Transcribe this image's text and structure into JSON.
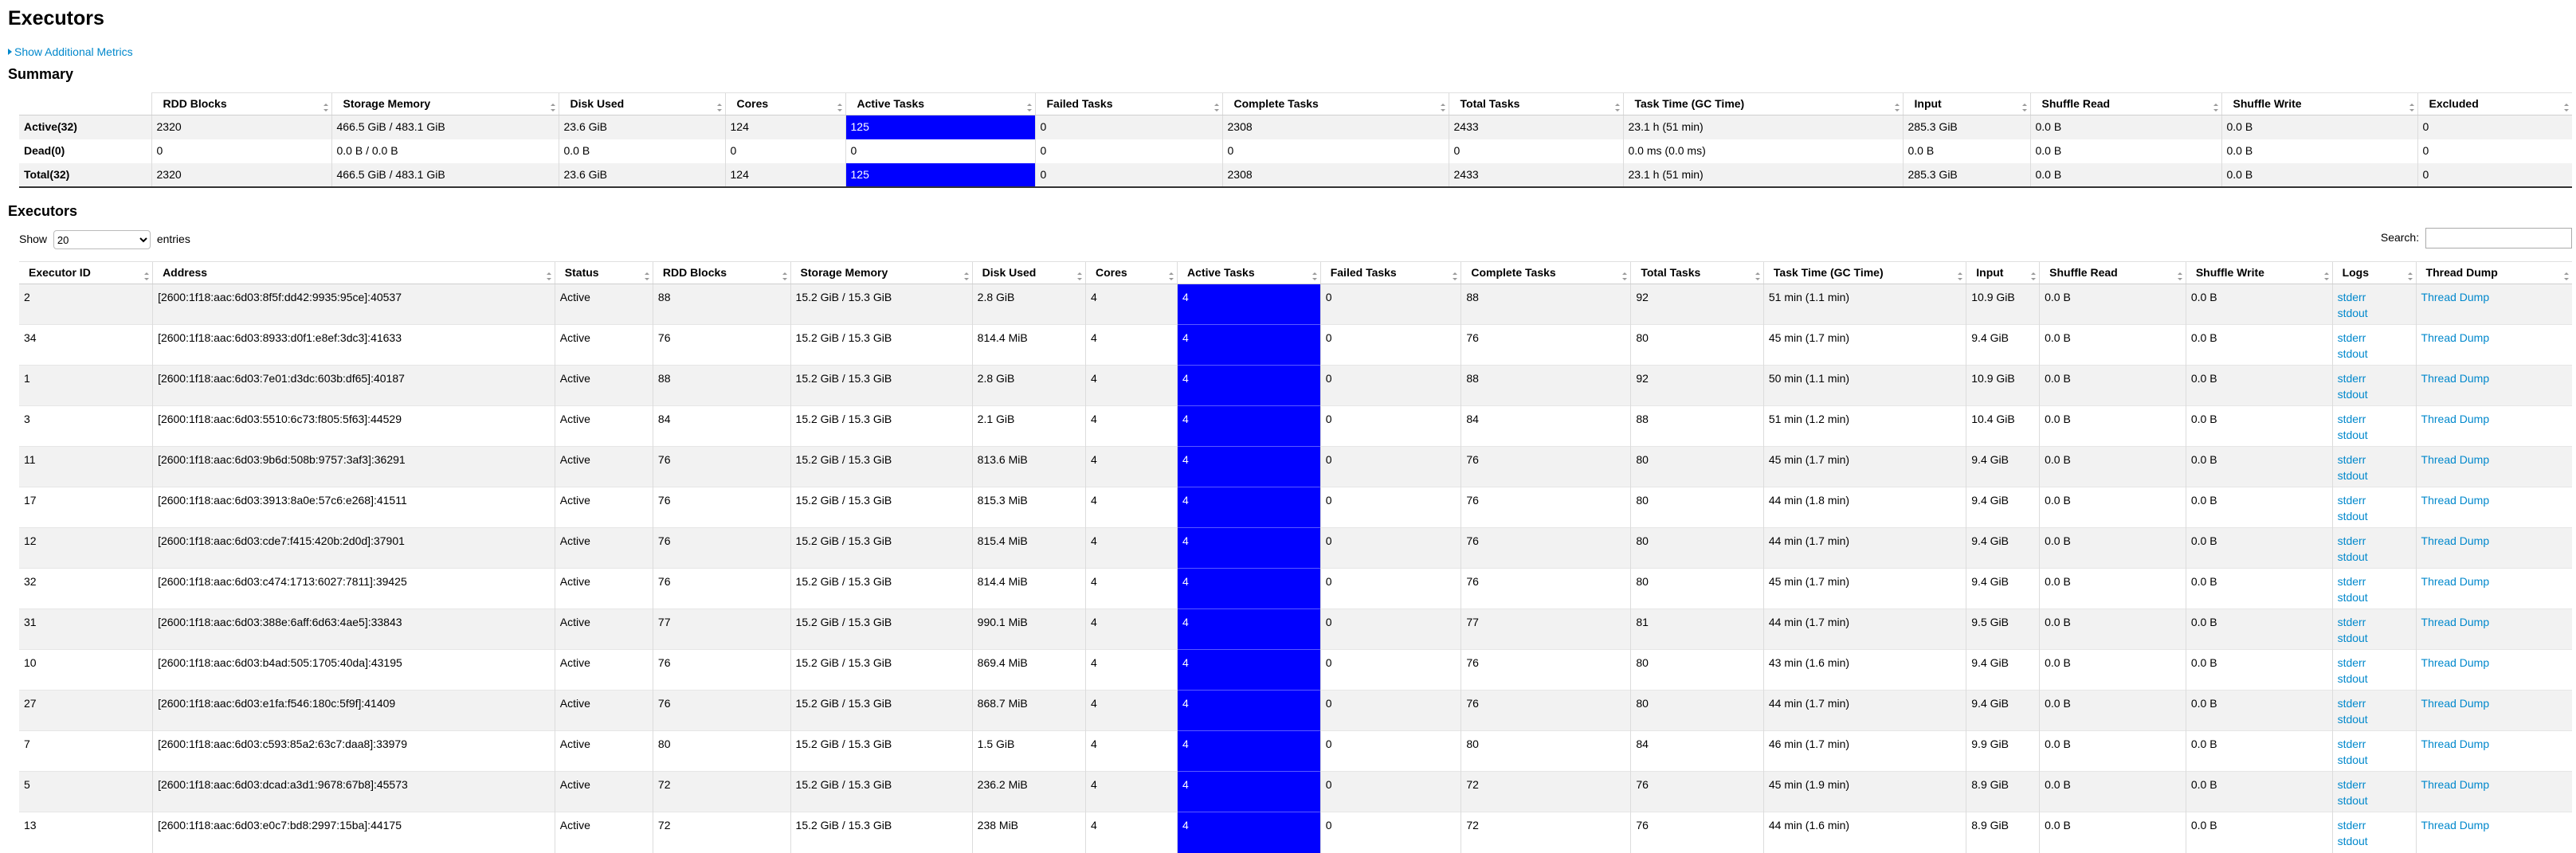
{
  "page_title": "Executors",
  "show_metrics_label": "Show Additional Metrics",
  "summary": {
    "title": "Summary",
    "columns": [
      "",
      "RDD Blocks",
      "Storage Memory",
      "Disk Used",
      "Cores",
      "Active Tasks",
      "Failed Tasks",
      "Complete Tasks",
      "Total Tasks",
      "Task Time (GC Time)",
      "Input",
      "Shuffle Read",
      "Shuffle Write",
      "Excluded"
    ],
    "rows": [
      [
        "Active(32)",
        "2320",
        "466.5 GiB / 483.1 GiB",
        "23.6 GiB",
        "124",
        "125",
        "0",
        "2308",
        "2433",
        "23.1 h (51 min)",
        "285.3 GiB",
        "0.0 B",
        "0.0 B",
        "0"
      ],
      [
        "Dead(0)",
        "0",
        "0.0 B / 0.0 B",
        "0.0 B",
        "0",
        "0",
        "0",
        "0",
        "0",
        "0.0 ms (0.0 ms)",
        "0.0 B",
        "0.0 B",
        "0.0 B",
        "0"
      ],
      [
        "Total(32)",
        "2320",
        "466.5 GiB / 483.1 GiB",
        "23.6 GiB",
        "124",
        "125",
        "0",
        "2308",
        "2433",
        "23.1 h (51 min)",
        "285.3 GiB",
        "0.0 B",
        "0.0 B",
        "0"
      ]
    ]
  },
  "executors": {
    "title": "Executors",
    "show_label": "Show",
    "entries_label": "entries",
    "page_size": "20",
    "search_label": "Search:",
    "search_value": "",
    "columns": [
      "Executor ID",
      "Address",
      "Status",
      "RDD Blocks",
      "Storage Memory",
      "Disk Used",
      "Cores",
      "Active Tasks",
      "Failed Tasks",
      "Complete Tasks",
      "Total Tasks",
      "Task Time (GC Time)",
      "Input",
      "Shuffle Read",
      "Shuffle Write",
      "Logs",
      "Thread Dump"
    ],
    "stderr_label": "stderr",
    "stdout_label": "stdout",
    "thread_dump_label": "Thread Dump",
    "rows": [
      [
        "2",
        "[2600:1f18:aac:6d03:8f5f:dd42:9935:95ce]:40537",
        "Active",
        "88",
        "15.2 GiB / 15.3 GiB",
        "2.8 GiB",
        "4",
        "4",
        "0",
        "88",
        "92",
        "51 min (1.1 min)",
        "10.9 GiB",
        "0.0 B",
        "0.0 B"
      ],
      [
        "34",
        "[2600:1f18:aac:6d03:8933:d0f1:e8ef:3dc3]:41633",
        "Active",
        "76",
        "15.2 GiB / 15.3 GiB",
        "814.4 MiB",
        "4",
        "4",
        "0",
        "76",
        "80",
        "45 min (1.7 min)",
        "9.4 GiB",
        "0.0 B",
        "0.0 B"
      ],
      [
        "1",
        "[2600:1f18:aac:6d03:7e01:d3dc:603b:df65]:40187",
        "Active",
        "88",
        "15.2 GiB / 15.3 GiB",
        "2.8 GiB",
        "4",
        "4",
        "0",
        "88",
        "92",
        "50 min (1.1 min)",
        "10.9 GiB",
        "0.0 B",
        "0.0 B"
      ],
      [
        "3",
        "[2600:1f18:aac:6d03:5510:6c73:f805:5f63]:44529",
        "Active",
        "84",
        "15.2 GiB / 15.3 GiB",
        "2.1 GiB",
        "4",
        "4",
        "0",
        "84",
        "88",
        "51 min (1.2 min)",
        "10.4 GiB",
        "0.0 B",
        "0.0 B"
      ],
      [
        "11",
        "[2600:1f18:aac:6d03:9b6d:508b:9757:3af3]:36291",
        "Active",
        "76",
        "15.2 GiB / 15.3 GiB",
        "813.6 MiB",
        "4",
        "4",
        "0",
        "76",
        "80",
        "45 min (1.7 min)",
        "9.4 GiB",
        "0.0 B",
        "0.0 B"
      ],
      [
        "17",
        "[2600:1f18:aac:6d03:3913:8a0e:57c6:e268]:41511",
        "Active",
        "76",
        "15.2 GiB / 15.3 GiB",
        "815.3 MiB",
        "4",
        "4",
        "0",
        "76",
        "80",
        "44 min (1.8 min)",
        "9.4 GiB",
        "0.0 B",
        "0.0 B"
      ],
      [
        "12",
        "[2600:1f18:aac:6d03:cde7:f415:420b:2d0d]:37901",
        "Active",
        "76",
        "15.2 GiB / 15.3 GiB",
        "815.4 MiB",
        "4",
        "4",
        "0",
        "76",
        "80",
        "44 min (1.7 min)",
        "9.4 GiB",
        "0.0 B",
        "0.0 B"
      ],
      [
        "32",
        "[2600:1f18:aac:6d03:c474:1713:6027:7811]:39425",
        "Active",
        "76",
        "15.2 GiB / 15.3 GiB",
        "814.4 MiB",
        "4",
        "4",
        "0",
        "76",
        "80",
        "45 min (1.7 min)",
        "9.4 GiB",
        "0.0 B",
        "0.0 B"
      ],
      [
        "31",
        "[2600:1f18:aac:6d03:388e:6aff:6d63:4ae5]:33843",
        "Active",
        "77",
        "15.2 GiB / 15.3 GiB",
        "990.1 MiB",
        "4",
        "4",
        "0",
        "77",
        "81",
        "44 min (1.7 min)",
        "9.5 GiB",
        "0.0 B",
        "0.0 B"
      ],
      [
        "10",
        "[2600:1f18:aac:6d03:b4ad:505:1705:40da]:43195",
        "Active",
        "76",
        "15.2 GiB / 15.3 GiB",
        "869.4 MiB",
        "4",
        "4",
        "0",
        "76",
        "80",
        "43 min (1.6 min)",
        "9.4 GiB",
        "0.0 B",
        "0.0 B"
      ],
      [
        "27",
        "[2600:1f18:aac:6d03:e1fa:f546:180c:5f9f]:41409",
        "Active",
        "76",
        "15.2 GiB / 15.3 GiB",
        "868.7 MiB",
        "4",
        "4",
        "0",
        "76",
        "80",
        "44 min (1.7 min)",
        "9.4 GiB",
        "0.0 B",
        "0.0 B"
      ],
      [
        "7",
        "[2600:1f18:aac:6d03:c593:85a2:63c7:daa8]:33979",
        "Active",
        "80",
        "15.2 GiB / 15.3 GiB",
        "1.5 GiB",
        "4",
        "4",
        "0",
        "80",
        "84",
        "46 min (1.7 min)",
        "9.9 GiB",
        "0.0 B",
        "0.0 B"
      ],
      [
        "5",
        "[2600:1f18:aac:6d03:dcad:a3d1:9678:67b8]:45573",
        "Active",
        "72",
        "15.2 GiB / 15.3 GiB",
        "236.2 MiB",
        "4",
        "4",
        "0",
        "72",
        "76",
        "45 min (1.9 min)",
        "8.9 GiB",
        "0.0 B",
        "0.0 B"
      ],
      [
        "13",
        "[2600:1f18:aac:6d03:e0c7:bd8:2997:15ba]:44175",
        "Active",
        "72",
        "15.2 GiB / 15.3 GiB",
        "238 MiB",
        "4",
        "4",
        "0",
        "72",
        "76",
        "44 min (1.6 min)",
        "8.9 GiB",
        "0.0 B",
        "0.0 B"
      ]
    ]
  },
  "colors": {
    "active_tasks_highlight": "#0000ff",
    "link": "#0088cc"
  }
}
